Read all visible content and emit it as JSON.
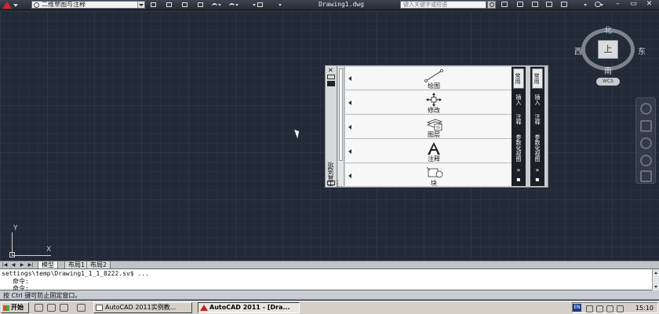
{
  "titlebar": {
    "workspace": "二维草图与注释",
    "doc_title": "Drawing1.dwg",
    "search_placeholder": "键入关键字或短语"
  },
  "viewcube": {
    "face": "上",
    "north": "北",
    "south": "南",
    "east": "东",
    "west": "西",
    "wcs": "WCS"
  },
  "ucs": {
    "x": "X",
    "y": "Y"
  },
  "palette": {
    "title": "工具选项板",
    "items": [
      {
        "label": "绘图",
        "icon": "line-icon"
      },
      {
        "label": "修改",
        "icon": "move-icon"
      },
      {
        "label": "图层",
        "icon": "layers-icon"
      },
      {
        "label": "注释",
        "icon": "text-a-icon"
      },
      {
        "label": "块",
        "icon": "block-icon"
      }
    ],
    "tabs_left": [
      "常用",
      "插入",
      "注释",
      "参数化",
      "视图"
    ],
    "tabs_right": [
      "常用",
      "插入",
      "注释",
      "参数化",
      "视图"
    ]
  },
  "layout_tabs": [
    "模型",
    "布局1",
    "布局2"
  ],
  "command": {
    "lines": [
      "settings\\temp\\Drawing1_1_1_8222.sv$ ...",
      "命令:",
      "命令:"
    ]
  },
  "status_text": "按 Ctrl 键可防止固定窗口。",
  "taskbar": {
    "start": "开始",
    "tasks": [
      "AutoCAD 2011实例教...",
      "AutoCAD 2011 - [Dra..."
    ],
    "ime": "EN",
    "clock": "15:10"
  }
}
